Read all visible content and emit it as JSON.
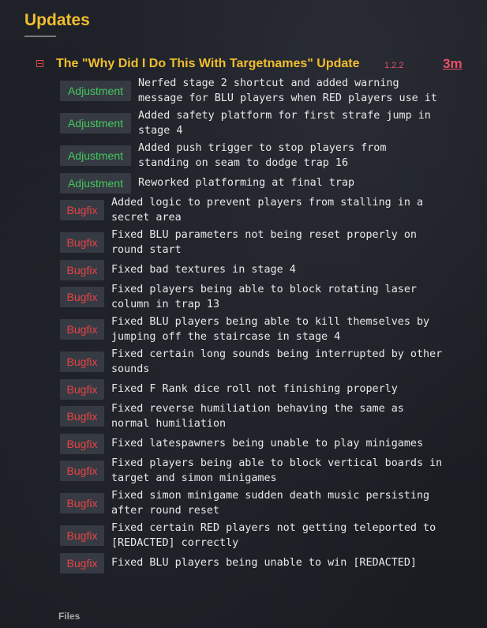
{
  "page": {
    "title": "Updates"
  },
  "update": {
    "title": "The \"Why Did I Do This With Targetnames\" Update",
    "version": "1.2.2",
    "age": "3m"
  },
  "colors": {
    "accent": "#f2be2e",
    "adjustment": "#43c95c",
    "bugfix": "#e84444",
    "version": "#e8506a"
  },
  "entries": [
    {
      "type": "Adjustment",
      "text": "Nerfed stage 2 shortcut and added warning\nmessage for BLU players when RED players use it"
    },
    {
      "type": "Adjustment",
      "text": "Added safety platform for first strafe jump in\nstage 4"
    },
    {
      "type": "Adjustment",
      "text": "Added push trigger to stop players from\nstanding on seam to dodge trap 16"
    },
    {
      "type": "Adjustment",
      "text": "Reworked platforming at final trap"
    },
    {
      "type": "Bugfix",
      "text": "Added logic to prevent players from stalling in a\nsecret area"
    },
    {
      "type": "Bugfix",
      "text": "Fixed BLU parameters not being reset properly on\nround start"
    },
    {
      "type": "Bugfix",
      "text": "Fixed bad textures in stage 4"
    },
    {
      "type": "Bugfix",
      "text": "Fixed players being able to block rotating laser\ncolumn in trap 13"
    },
    {
      "type": "Bugfix",
      "text": "Fixed BLU players being able to kill themselves by\njumping off the staircase in stage 4"
    },
    {
      "type": "Bugfix",
      "text": "Fixed certain long sounds being interrupted by other\nsounds"
    },
    {
      "type": "Bugfix",
      "text": "Fixed F Rank dice roll not finishing properly"
    },
    {
      "type": "Bugfix",
      "text": "Fixed reverse humiliation behaving the same as\nnormal humiliation"
    },
    {
      "type": "Bugfix",
      "text": "Fixed latespawners being unable to play minigames"
    },
    {
      "type": "Bugfix",
      "text": "Fixed players being able to block vertical boards in\ntarget and simon minigames"
    },
    {
      "type": "Bugfix",
      "text": "Fixed simon minigame sudden death music persisting\nafter round reset"
    },
    {
      "type": "Bugfix",
      "text": "Fixed certain RED players not getting teleported to\n[REDACTED] correctly"
    },
    {
      "type": "Bugfix",
      "text": "Fixed BLU players being unable to win [REDACTED]"
    }
  ],
  "files": {
    "label": "Files"
  }
}
